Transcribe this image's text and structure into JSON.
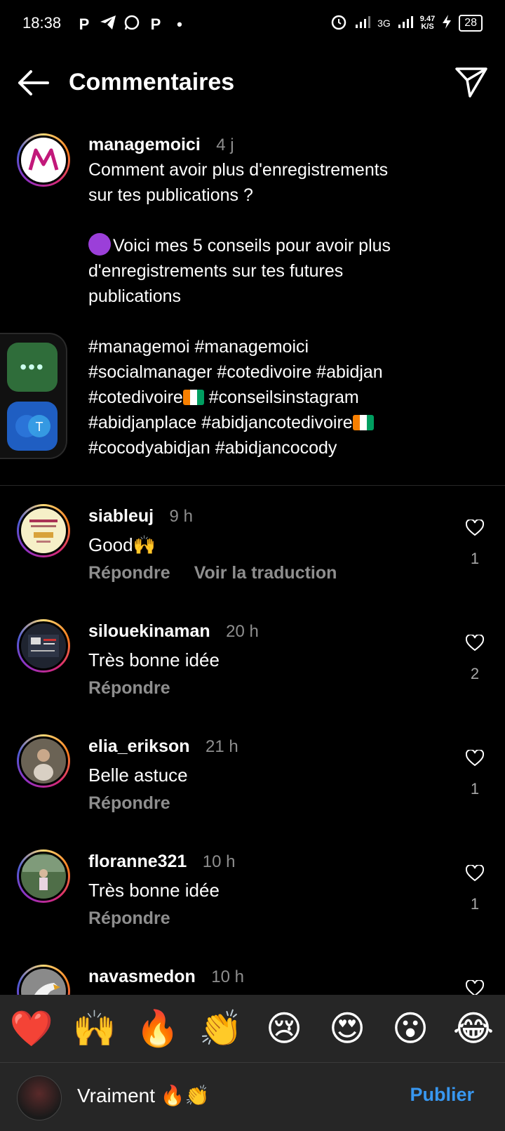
{
  "status_bar": {
    "time": "18:38",
    "notif_icons": [
      "P",
      "telegram-icon",
      "whatsapp-icon",
      "P",
      "•"
    ],
    "network": "3G",
    "speed_value": "9.47",
    "speed_unit": "K/S",
    "battery": "28"
  },
  "header": {
    "title": "Commentaires"
  },
  "caption": {
    "username": "managemoici",
    "time": "4 j",
    "line1": "Comment avoir plus d'enregistrements",
    "line2": "sur tes publications ?",
    "line3": "Voici mes 5 conseils pour avoir plus",
    "line4": "d'enregistrements sur tes futures",
    "line5": "publications",
    "line6": "#managemoi #managemoici",
    "line7": "#socialmanager #cotedivoire #abidjan",
    "line8a": "#cotedivoire",
    "line8b": " #conseilsinstagram",
    "line9": "#abidjanplace #abidjancotedivoire",
    "line10": "#cocodyabidjan #abidjancocody"
  },
  "comments": [
    {
      "username": "siableuj",
      "time": "9 h",
      "text": "Good🙌",
      "reply": "Répondre",
      "translate": "Voir la traduction",
      "likes": "1"
    },
    {
      "username": "silouekinaman",
      "time": "20 h",
      "text": "Très bonne idée",
      "reply": "Répondre",
      "likes": "2"
    },
    {
      "username": "elia_erikson",
      "time": "21 h",
      "text": "Belle astuce",
      "reply": "Répondre",
      "likes": "1"
    },
    {
      "username": "floranne321",
      "time": "10 h",
      "text": "Très bonne idée",
      "reply": "Répondre",
      "likes": "1"
    },
    {
      "username": "navasmedon",
      "time": "10 h"
    }
  ],
  "emoji_bar": [
    "❤️",
    "🙌",
    "🔥",
    "👏",
    "😢",
    "😍",
    "😮",
    "😂"
  ],
  "input": {
    "value": "Vraiment 🔥👏",
    "publish_label": "Publier"
  },
  "colors": {
    "background": "#000000",
    "muted_text": "#8e8e8e",
    "publish_blue": "#3897f0",
    "bar_background": "#262626"
  }
}
